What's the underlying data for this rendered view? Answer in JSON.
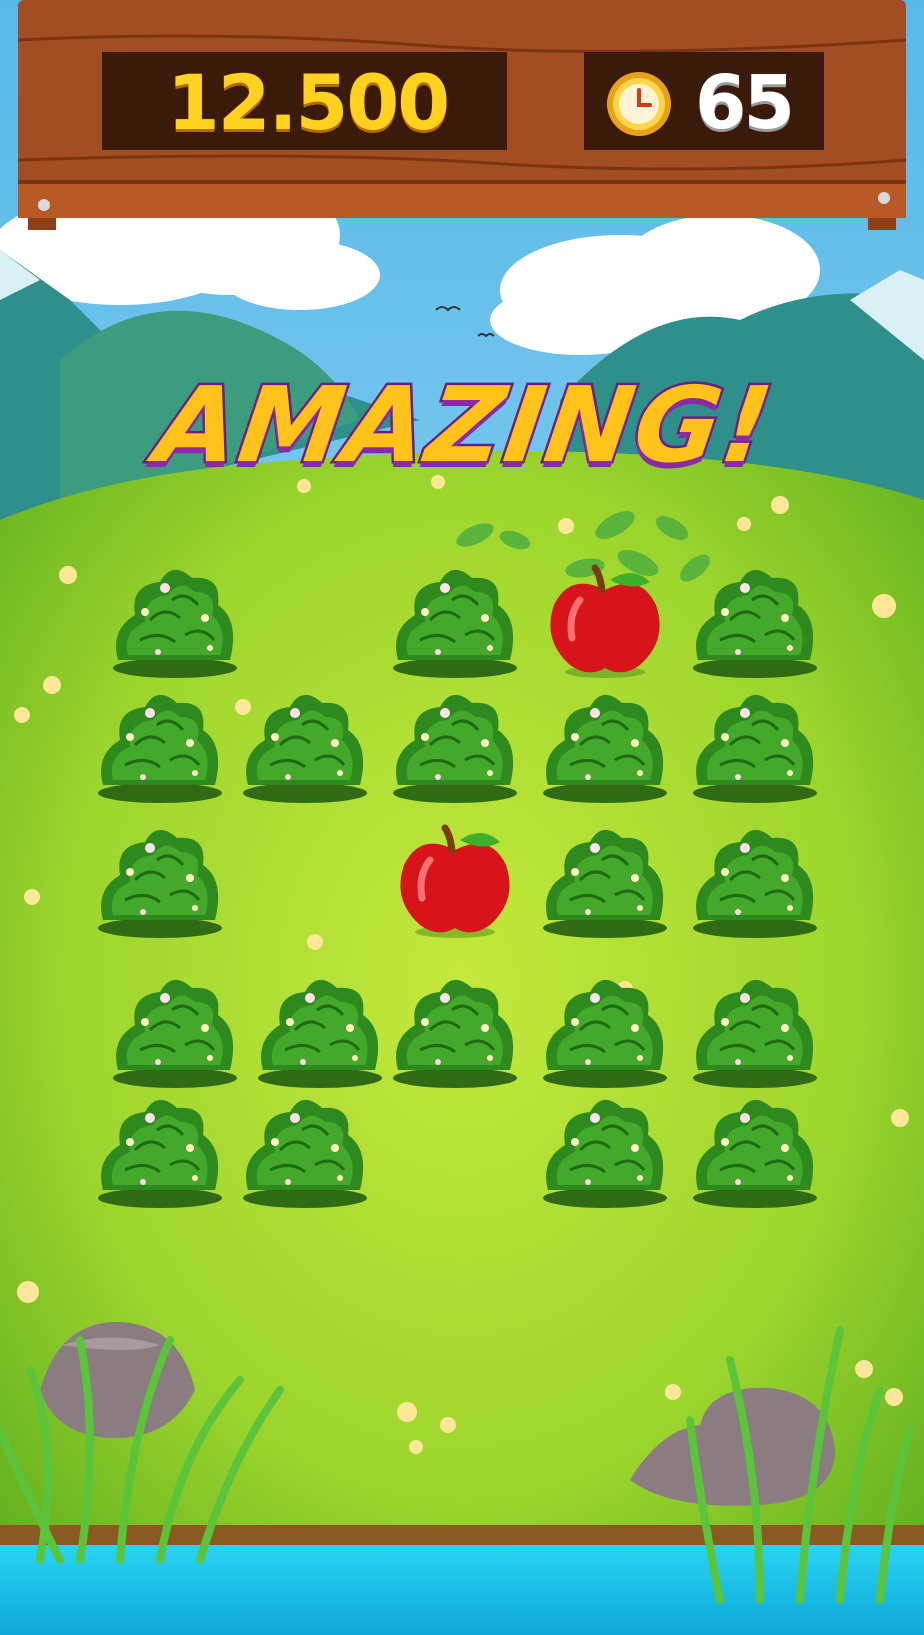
{
  "hud": {
    "score": "12.500",
    "timer": "65",
    "timer_icon": "clock-icon"
  },
  "banner": {
    "text": "AMAZING!"
  },
  "board": {
    "rows": [
      [
        "bush",
        "empty",
        "bush",
        "apple",
        "bush"
      ],
      [
        "bush",
        "bush",
        "bush",
        "bush",
        "bush"
      ],
      [
        "bush",
        "empty",
        "apple",
        "bush",
        "bush"
      ],
      [
        "bush",
        "bush",
        "bush",
        "bush",
        "bush"
      ],
      [
        "bush",
        "bush",
        "empty",
        "bush",
        "bush"
      ]
    ]
  },
  "colors": {
    "sky": "#8fd3f4",
    "meadow": "#9ed62e",
    "wood": "#a34e22",
    "score_text": "#ffd21f",
    "banner_fill": "#ffc21a",
    "banner_outline": "#6a1f86",
    "water": "#1fc4ea"
  }
}
